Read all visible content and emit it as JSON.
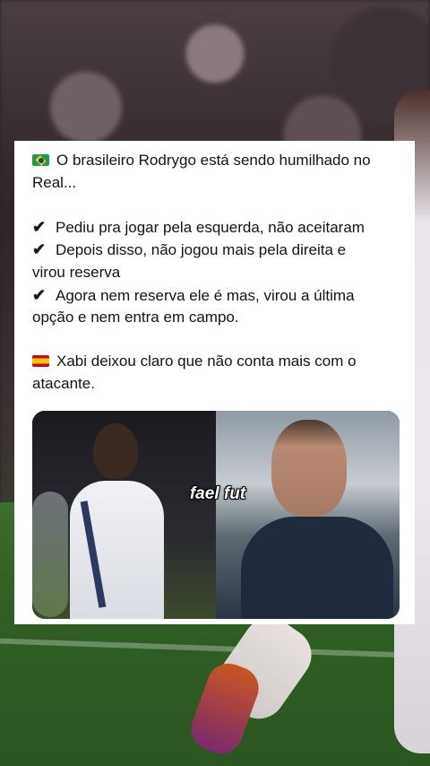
{
  "post": {
    "line1": "O brasileiro Rodrygo está sendo humilhado no",
    "line2": "Real...",
    "check1": "Pediu pra jogar pela esquerda, não aceitaram",
    "check2a": "Depois disso, não jogou mais pela direita e",
    "check2b": "virou reserva",
    "check3a": "Agora nem reserva ele é mas, virou a última",
    "check3b": "opção e nem entra em campo.",
    "spain_a": "Xabi deixou claro que não conta mais com o",
    "spain_b": "atacante.",
    "check_glyph": "✔",
    "flag_brazil": "brazil-flag-icon",
    "flag_spain": "spain-flag-icon"
  },
  "media": {
    "watermark": "fael fut"
  },
  "colors": {
    "card_bg": "#ffffff",
    "text": "#0f1419",
    "pitch": "#2f5f22"
  }
}
